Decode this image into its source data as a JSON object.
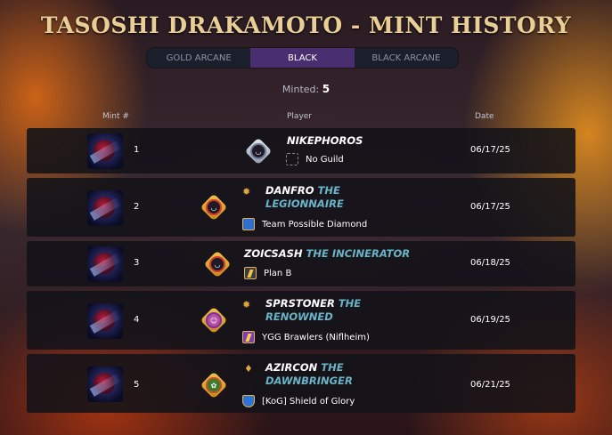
{
  "page": {
    "title": "TASOSHI DRAKAMOTO - MINT HISTORY"
  },
  "tabs": [
    {
      "label": "GOLD ARCANE",
      "active": false
    },
    {
      "label": "BLACK",
      "active": true
    },
    {
      "label": "BLACK ARCANE",
      "active": false
    }
  ],
  "minted": {
    "label": "Minted:",
    "count": "5"
  },
  "columns": {
    "mint": "Mint #",
    "player": "Player",
    "date": "Date"
  },
  "rows": [
    {
      "mint": "1",
      "name": "NIKEPHOROS",
      "epithet": "",
      "guild": "No Guild",
      "date": "06/17/25"
    },
    {
      "mint": "2",
      "name": "DANFRO",
      "epithet": "THE",
      "epithet2": "LEGIONNAIRE",
      "guild": "Team Possible Diamond",
      "date": "06/17/25"
    },
    {
      "mint": "3",
      "name": "ZOICSASH",
      "epithet": "THE INCINERATOR",
      "guild": "Plan B",
      "date": "06/18/25"
    },
    {
      "mint": "4",
      "name": "SPRSTONER",
      "epithet": "THE",
      "epithet2": "RENOWNED",
      "guild": "YGG Brawlers (Niflheim)",
      "date": "06/19/25"
    },
    {
      "mint": "5",
      "name": "AZIRCON",
      "epithet": "THE",
      "epithet2": "DAWNBRINGER",
      "guild": "[KoG] Shield of Glory",
      "date": "06/21/25"
    }
  ],
  "icons": {
    "card": "card-art-icon",
    "avatar": "player-avatar-icon",
    "rank": "rank-emblem-icon",
    "guild": "guild-crest-icon"
  },
  "colors": {
    "title": "#e9cf96",
    "epithet": "#6ab4c8",
    "active_tab": "#4a2f70"
  }
}
